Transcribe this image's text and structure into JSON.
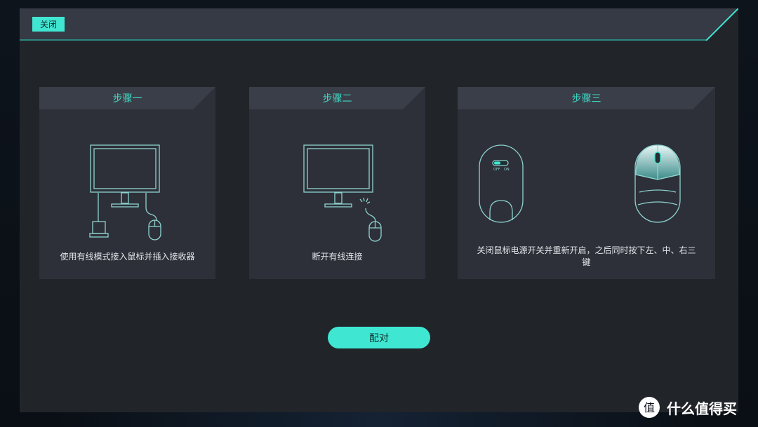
{
  "header": {
    "close_label": "关闭"
  },
  "steps": [
    {
      "title": "步骤一",
      "description": "使用有线模式接入鼠标并插入接收器"
    },
    {
      "title": "步骤二",
      "description": "断开有线连接"
    },
    {
      "title": "步骤三",
      "description": "关闭鼠标电源开关并重新开启，之后同时按下左、中、右三键"
    }
  ],
  "mouse_switch": {
    "off_label": "OFF",
    "on_label": "ON"
  },
  "actions": {
    "pair_label": "配对"
  },
  "watermark": {
    "text": "什么值得买"
  },
  "colors": {
    "accent": "#3fe7d3",
    "panel": "#212429",
    "card": "#2d3039",
    "line": "#8fd3cf"
  }
}
